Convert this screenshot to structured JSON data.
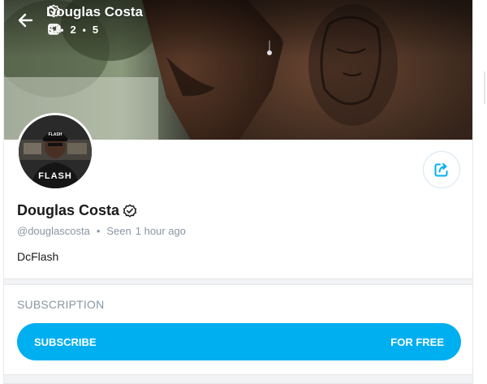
{
  "header": {
    "name": "Douglas Costa",
    "stats": {
      "photos": "5",
      "videos": "2",
      "likes": "5"
    }
  },
  "profile": {
    "name": "Douglas Costa",
    "username": "@douglascosta",
    "seen_label": "Seen",
    "seen_time": "1 hour ago",
    "bio": "DcFlash",
    "avatar_shirt_text": "FLASH",
    "avatar_cap_text": "FLASH"
  },
  "subscription": {
    "section_title": "SUBSCRIPTION",
    "button_label": "SUBSCRIBE",
    "price_label": "FOR FREE"
  },
  "colors": {
    "accent": "#00aff0",
    "muted_text": "#8a96a3",
    "verified_badge": "#1a1a1a"
  },
  "icons": {
    "back": "arrow-left-icon",
    "photos": "image-icon",
    "videos": "video-icon",
    "likes": "heart-icon",
    "verified": "verified-badge-icon",
    "share": "share-icon"
  }
}
